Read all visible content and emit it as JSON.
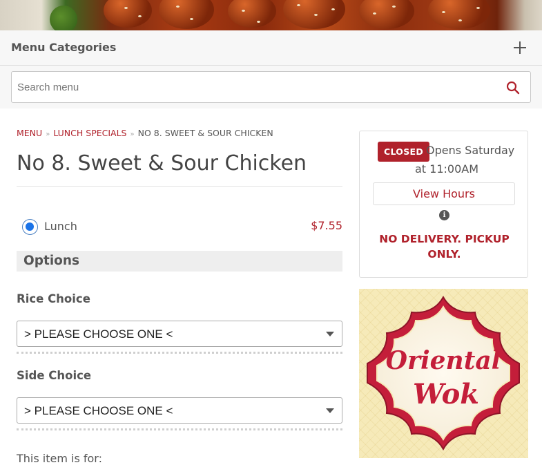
{
  "header": {
    "categories_title": "Menu Categories"
  },
  "search": {
    "placeholder": "Search menu"
  },
  "breadcrumb": {
    "items": [
      "MENU",
      "LUNCH SPECIALS"
    ],
    "current": "NO 8. SWEET & SOUR CHICKEN"
  },
  "item": {
    "title": "No 8. Sweet & Sour Chicken",
    "sizes": [
      {
        "label": "Lunch",
        "price": "$7.55",
        "selected": true
      }
    ]
  },
  "options": {
    "heading": "Options",
    "choices": [
      {
        "label": "Rice Choice",
        "selected": "> PLEASE CHOOSE ONE <"
      },
      {
        "label": "Side Choice",
        "selected": "> PLEASE CHOOSE ONE <"
      }
    ],
    "item_for_label": "This item is for:"
  },
  "status": {
    "badge": "CLOSED",
    "opens_line1": "Opens Saturday",
    "opens_line2": "at 11:00AM",
    "view_hours": "View Hours",
    "notice": "NO DELIVERY. PICKUP ONLY."
  },
  "logo": {
    "line1": "Oriental",
    "line2": "Wok"
  },
  "colors": {
    "accent": "#b0212b",
    "logo_background": "#f6eab9",
    "radio": "#1a73e8"
  },
  "icons": [
    "plus-icon",
    "search-icon",
    "chevron-down-icon",
    "info-icon"
  ]
}
